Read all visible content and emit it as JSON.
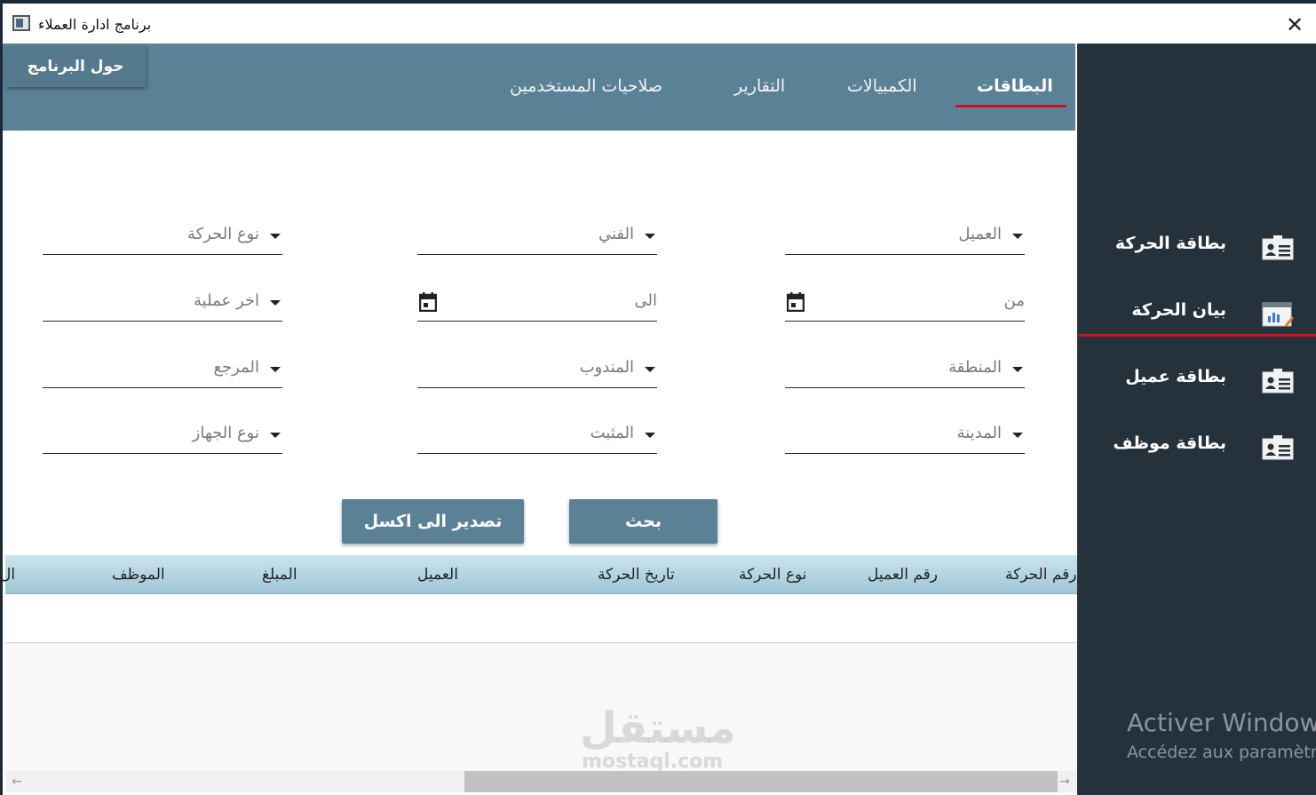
{
  "window": {
    "title": "برنامج ادارة العملاء",
    "close_glyph": "✕"
  },
  "about_button": "حول البرنامج",
  "tabs": [
    {
      "label": "البطاقات",
      "active": true
    },
    {
      "label": "الكمبيالات",
      "active": false
    },
    {
      "label": "التقارير",
      "active": false
    },
    {
      "label": "صلاحيات المستخدمين",
      "active": false
    }
  ],
  "sidebar": {
    "items": [
      {
        "label": "بطاقة الحركة",
        "icon": "id-card-icon"
      },
      {
        "label": "بيان الحركة",
        "icon": "report-chart-icon",
        "active": true
      },
      {
        "label": "بطاقة عميل",
        "icon": "id-card-icon"
      },
      {
        "label": "بطاقة موظف",
        "icon": "id-card-icon"
      }
    ],
    "activation_title": "Activer Windows",
    "activation_sub": "Accédez aux paramètr"
  },
  "form": {
    "client": "العميل",
    "technician": "الفني",
    "movement_type": "نوع الحركة",
    "from": "من",
    "to": "الى",
    "last_operation": "اخر عملية",
    "region": "المنطقة",
    "representative": "المندوب",
    "reference": "المرجع",
    "city": "المدينة",
    "installer": "المثبت",
    "device_type": "نوع الجهاز"
  },
  "buttons": {
    "search": "بحث",
    "export": "تصدير الى اكسل"
  },
  "grid": {
    "columns": [
      "رقم الحركة",
      "رقم العميل",
      "نوع الحركة",
      "تاريخ الحركة",
      "العميل",
      "المبلغ",
      "الموظف",
      "ال"
    ]
  },
  "watermark": {
    "logo": "مستقل",
    "site": "mostaql.com"
  },
  "colors": {
    "header": "#5b8196",
    "sidebar": "#25323c",
    "accent": "#d0121b"
  }
}
